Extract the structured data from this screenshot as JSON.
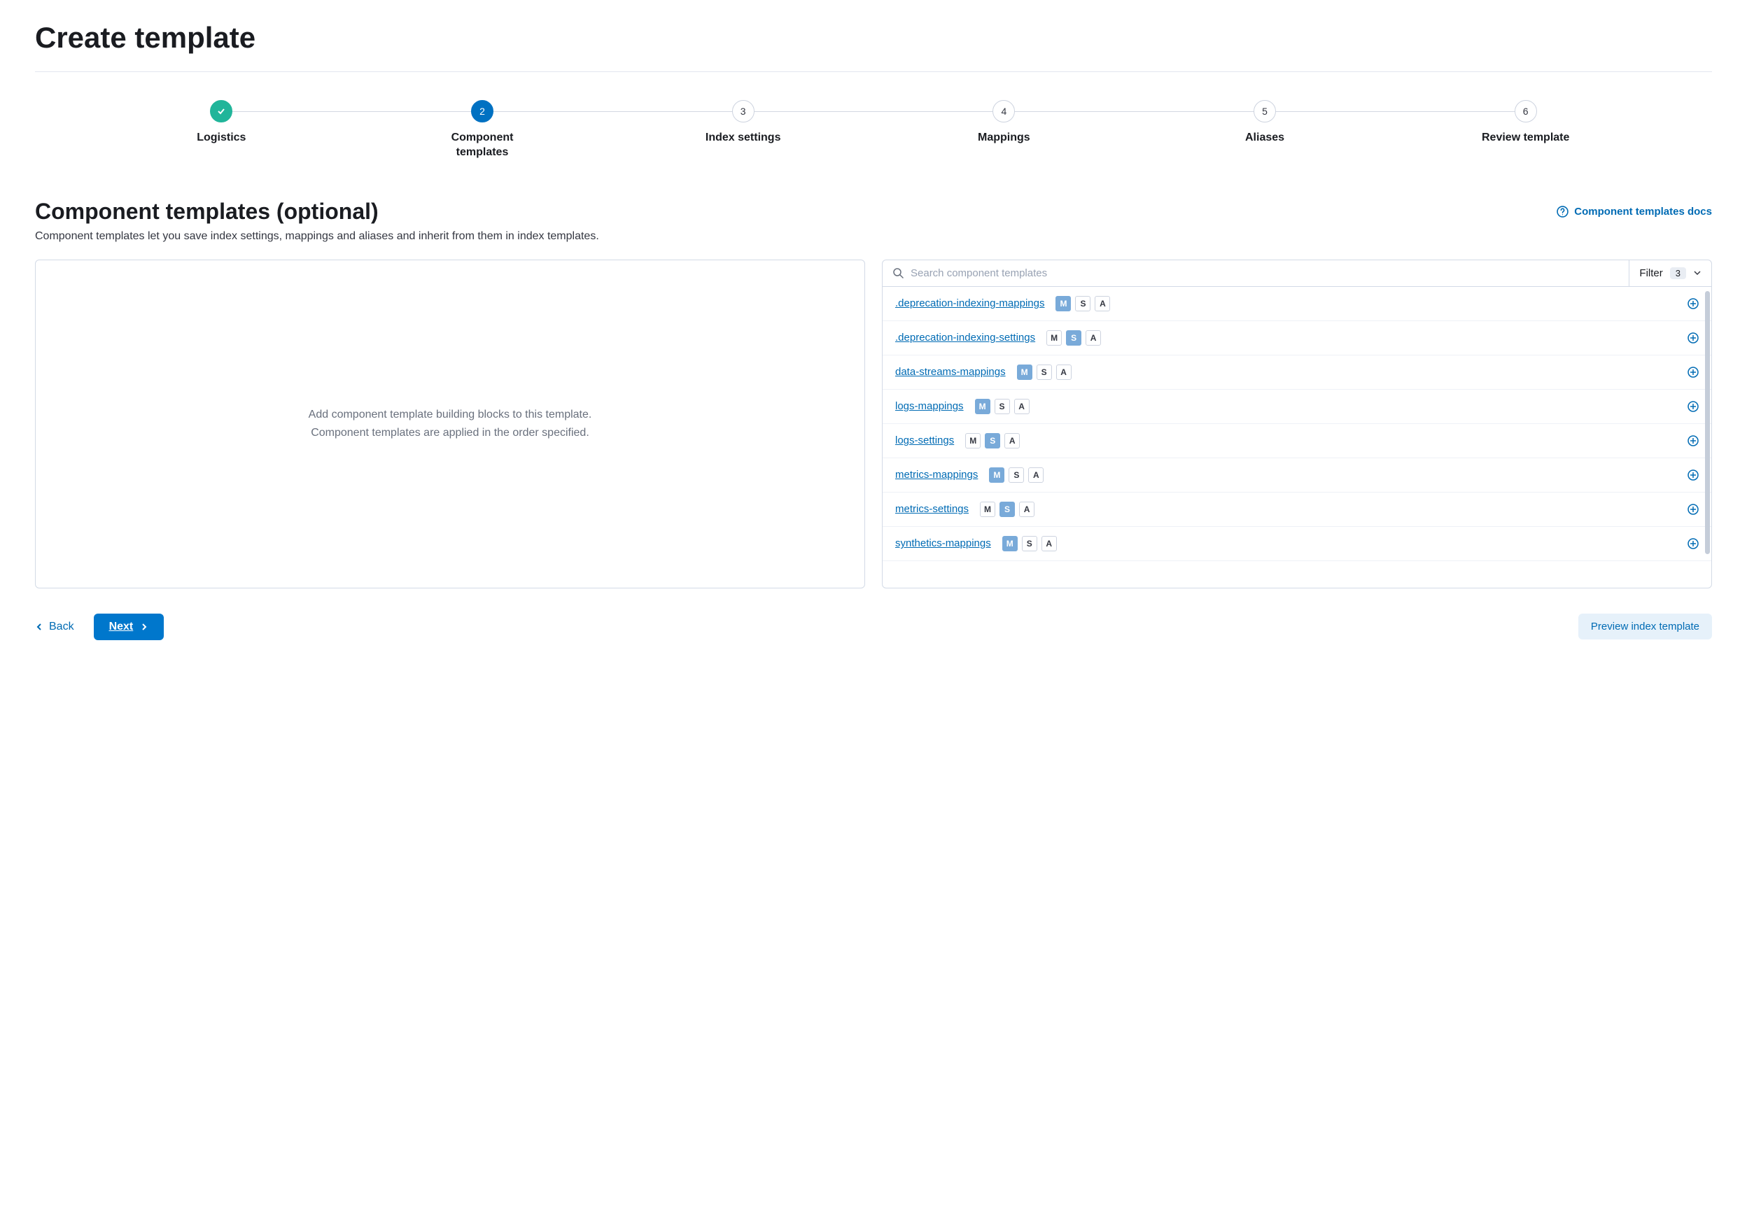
{
  "page_title": "Create template",
  "steps": [
    {
      "label": "Logistics",
      "state": "complete",
      "num": ""
    },
    {
      "label": "Component templates",
      "state": "active",
      "num": "2"
    },
    {
      "label": "Index settings",
      "state": "",
      "num": "3"
    },
    {
      "label": "Mappings",
      "state": "",
      "num": "4"
    },
    {
      "label": "Aliases",
      "state": "",
      "num": "5"
    },
    {
      "label": "Review template",
      "state": "",
      "num": "6"
    }
  ],
  "section": {
    "title": "Component templates (optional)",
    "docs_link": "Component templates docs",
    "description": "Component templates let you save index settings, mappings and aliases and inherit from them in index templates."
  },
  "left_panel": {
    "empty_line1": "Add component template building blocks to this template.",
    "empty_line2": "Component templates are applied in the order specified."
  },
  "right_panel": {
    "search_placeholder": "Search component templates",
    "filter_label": "Filter",
    "filter_count": "3",
    "items": [
      {
        "name": ".deprecation-indexing-mappings",
        "m": true,
        "s": false,
        "a": false
      },
      {
        "name": ".deprecation-indexing-settings",
        "m": false,
        "s": true,
        "a": false
      },
      {
        "name": "data-streams-mappings",
        "m": true,
        "s": false,
        "a": false
      },
      {
        "name": "logs-mappings",
        "m": true,
        "s": false,
        "a": false
      },
      {
        "name": "logs-settings",
        "m": false,
        "s": true,
        "a": false
      },
      {
        "name": "metrics-mappings",
        "m": true,
        "s": false,
        "a": false
      },
      {
        "name": "metrics-settings",
        "m": false,
        "s": true,
        "a": false
      },
      {
        "name": "synthetics-mappings",
        "m": true,
        "s": false,
        "a": false
      }
    ],
    "badge_labels": {
      "m": "M",
      "s": "S",
      "a": "A"
    }
  },
  "footer": {
    "back": "Back",
    "next": "Next",
    "preview": "Preview index template"
  }
}
